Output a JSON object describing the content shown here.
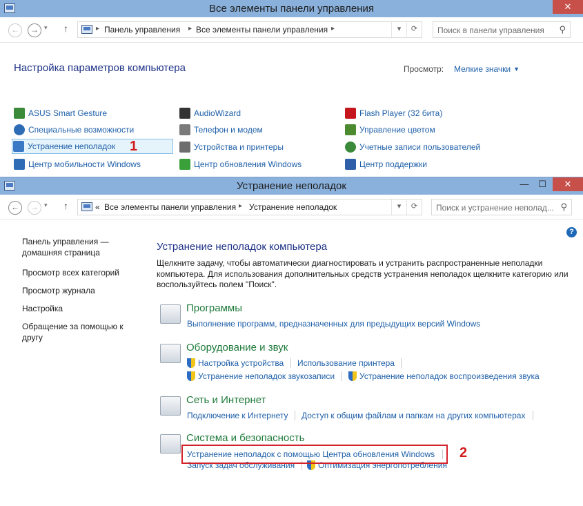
{
  "window1": {
    "title": "Все элементы панели управления",
    "breadcrumb": [
      "Панель управления",
      "Все элементы панели управления"
    ],
    "search_placeholder": "Поиск в панели управления",
    "page_title": "Настройка параметров компьютера",
    "view_label": "Просмотр:",
    "view_value": "Мелкие значки",
    "items": [
      {
        "label": "ASUS Smart Gesture",
        "icon": "asus-gesture-icon",
        "color": "#3a8a3a"
      },
      {
        "label": "AudioWizard",
        "icon": "audiowizard-icon",
        "color": "#333333"
      },
      {
        "label": "Flash Player (32 бита)",
        "icon": "flash-icon",
        "color": "#c4161c"
      },
      {
        "label": "Специальные возможности",
        "icon": "accessibility-icon",
        "color": "#2e6db5"
      },
      {
        "label": "Телефон и модем",
        "icon": "phone-modem-icon",
        "color": "#7a7a7a"
      },
      {
        "label": "Управление цветом",
        "icon": "color-management-icon",
        "color": "#4b8a2f"
      },
      {
        "label": "Устранение неполадок",
        "icon": "troubleshooting-icon",
        "color": "#3a7ac4",
        "selected": true
      },
      {
        "label": "Устройства и принтеры",
        "icon": "devices-printers-icon",
        "color": "#6d6d6d"
      },
      {
        "label": "Учетные записи пользователей",
        "icon": "user-accounts-icon",
        "color": "#3a8a3a"
      },
      {
        "label": "Центр мобильности Windows",
        "icon": "mobility-center-icon",
        "color": "#2e6db5"
      },
      {
        "label": "Центр обновления Windows",
        "icon": "windows-update-icon",
        "color": "#3aa13a"
      },
      {
        "label": "Центр поддержки",
        "icon": "action-center-flag-icon",
        "color": "#2e5fa8"
      }
    ],
    "marker": "1"
  },
  "window2": {
    "title": "Устранение неполадок",
    "breadcrumb_prefix": "«",
    "breadcrumb": [
      "Все элементы панели управления",
      "Устранение неполадок"
    ],
    "search_placeholder": "Поиск и устранение неполад...",
    "left_nav": {
      "home": "Панель управления — домашняя страница",
      "links": [
        "Просмотр всех категорий",
        "Просмотр журнала",
        "Настройка",
        "Обращение за помощью к другу"
      ]
    },
    "heading": "Устранение неполадок компьютера",
    "description": "Щелкните задачу, чтобы автоматически диагностировать и устранить распространенные неполадки компьютера. Для использования дополнительных средств устранения неполадок щелкните категорию или воспользуйтесь полем \"Поиск\".",
    "categories": [
      {
        "title": "Программы",
        "icon": "programs-icon",
        "links": [
          "Выполнение программ, предназначенных для предыдущих версий Windows"
        ]
      },
      {
        "title": "Оборудование и звук",
        "icon": "hardware-sound-icon",
        "links": [
          "Настройка устройства",
          "Использование принтера",
          "Устранение неполадок звукозаписи",
          "Устранение неполадок воспроизведения звука"
        ]
      },
      {
        "title": "Сеть и Интернет",
        "icon": "network-internet-icon",
        "links": [
          "Подключение к Интернету",
          "Доступ к общим файлам и папкам на других компьютерах"
        ]
      },
      {
        "title": "Система и безопасность",
        "icon": "system-security-icon",
        "links": [
          "Устранение неполадок с помощью Центра обновления Windows",
          "Запуск задач обслуживания",
          "Оптимизация энергопотребления"
        ]
      }
    ],
    "marker": "2",
    "help": "?"
  },
  "accent_colors": {
    "titlebar": "#8ab1dc",
    "link": "#1e5fa8",
    "category": "#1f7a3a",
    "highlight": "#d4222a"
  }
}
